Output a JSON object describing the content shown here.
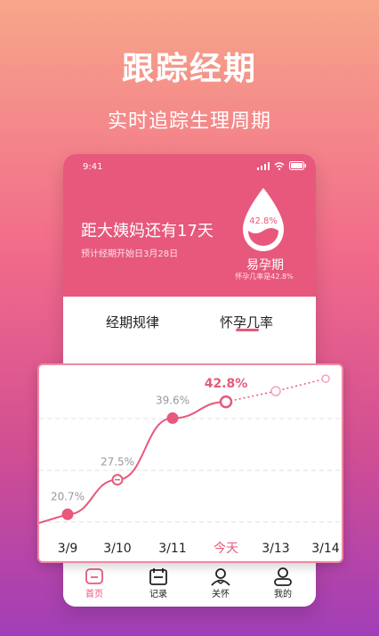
{
  "headline": {
    "title": "跟踪经期",
    "subtitle": "实时追踪生理周期"
  },
  "status": {
    "time": "9:41"
  },
  "summary": {
    "countdown": "距大姨妈还有17天",
    "subline": "预计经期开始日3月28日",
    "drop_percent": "42.8%",
    "phase": "易孕期",
    "phase_sub": "怀孕几率是42.8%"
  },
  "tabs": [
    {
      "label": "经期规律",
      "active": false
    },
    {
      "label": "怀孕几率",
      "active": true
    }
  ],
  "chart_data": {
    "type": "line",
    "categories": [
      "3/9",
      "3/10",
      "3/11",
      "今天",
      "3/13",
      "3/14"
    ],
    "values": [
      20.7,
      27.5,
      39.6,
      42.8,
      null,
      null
    ],
    "value_labels": [
      "20.7%",
      "27.5%",
      "39.6%",
      "42.8%"
    ],
    "highlight_index": 3,
    "accent": "#e7587c",
    "grid": true
  },
  "nav": [
    {
      "label": "首页",
      "icon": "home-icon",
      "active": true
    },
    {
      "label": "记录",
      "icon": "calendar-icon",
      "active": false
    },
    {
      "label": "关怀",
      "icon": "care-icon",
      "active": false
    },
    {
      "label": "我的",
      "icon": "user-icon",
      "active": false
    }
  ],
  "colors": {
    "accent": "#e7587c",
    "card_border": "#f08aa4"
  }
}
